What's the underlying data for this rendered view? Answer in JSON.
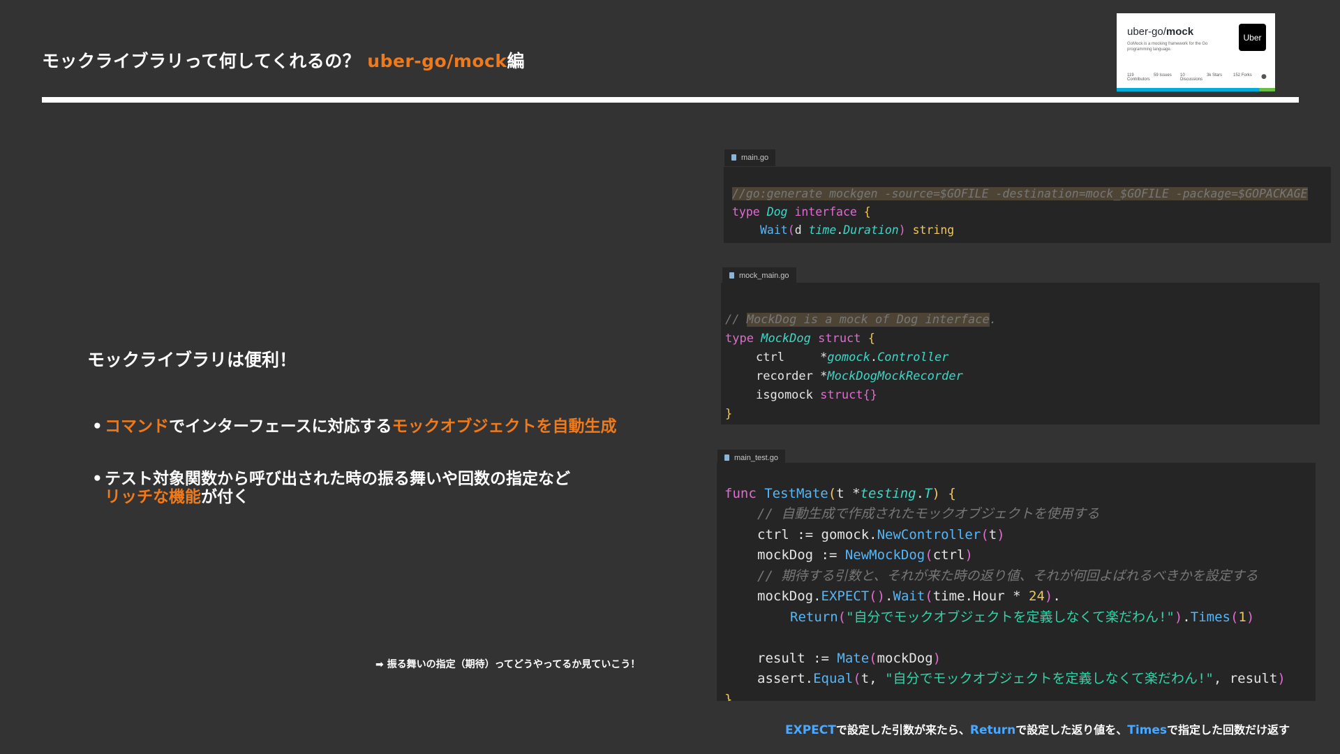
{
  "slide": {
    "title_main": "モックライブラリって何してくれるの？",
    "title_accent": "uber-go/mock",
    "title_suffix": "編",
    "heading": "モックライブラリは便利！",
    "bullet1": {
      "part1": "コマンド",
      "part2": "でインターフェースに対応する",
      "part3": "モックオブジェクトを自動生成"
    },
    "bullet2": {
      "line1": "テスト対象関数から呼び出された時の振る舞いや回数の指定など",
      "part_accent": "リッチな機能",
      "part_tail": "が付く"
    },
    "arrow_note": "➡ 振る舞いの指定（期待）ってどうやってるか見ていこう！",
    "bullet_dot": "•"
  },
  "repo_card": {
    "owner": "uber-go/",
    "name": "mock",
    "description": "GoMock is a mocking framework for the Go programming language.",
    "logo_text": "Uber",
    "stats": [
      {
        "value": "119",
        "label": "Contributors"
      },
      {
        "value": "59",
        "label": "Issues"
      },
      {
        "value": "10",
        "label": "Discussions"
      },
      {
        "value": "3k",
        "label": "Stars"
      },
      {
        "value": "152",
        "label": "Forks"
      }
    ]
  },
  "files": {
    "main": "main.go",
    "mock": "mock_main.go",
    "test": "main_test.go"
  },
  "code_main": {
    "l1": "//go:generate mockgen -source=$GOFILE -destination=mock_$GOFILE -package=$GOPACKAGE",
    "l2_kw": "type",
    "l2_name": "Dog",
    "l2_kw2": "interface",
    "l2_brace": "{",
    "l3_fn": "Wait",
    "l3_open": "(",
    "l3_param": "d ",
    "l3_pkg": "time",
    "l3_dot": ".",
    "l3_type": "Duration",
    "l3_close": ")",
    "l3_ret": "string",
    "l4": "}"
  },
  "code_mock": {
    "l1_prefix": "// ",
    "l1_hl": "MockDog is a mock of Dog interface",
    "l1_end": ".",
    "l2_kw": "type",
    "l2_name": "MockDog",
    "l2_kw2": "struct",
    "l2_brace": "{",
    "l3_field": "ctrl",
    "l3_star": "*",
    "l3_pkg": "gomock",
    "l3_dot": ".",
    "l3_type": "Controller",
    "l4_field": "recorder",
    "l4_star": "*",
    "l4_type": "MockDogMockRecorder",
    "l5_field": "isgomock",
    "l5_type": "struct{}",
    "l6": "}"
  },
  "code_test": {
    "l1_kw": "func",
    "l1_fn": "TestMate",
    "l1_open": "(",
    "l1_param": "t ",
    "l1_star": "*",
    "l1_pkg": "testing",
    "l1_dot": ".",
    "l1_type": "T",
    "l1_close": ")",
    "l1_brace": "{",
    "l2": "// 自動生成で作成されたモックオブジェクトを使用する",
    "l3_var": "ctrl := gomock.",
    "l3_fn": "NewController",
    "l3_open": "(",
    "l3_arg": "t",
    "l3_close": ")",
    "l4_var": "mockDog := ",
    "l4_fn": "NewMockDog",
    "l4_open": "(",
    "l4_arg": "ctrl",
    "l4_close": ")",
    "l5": "// 期待する引数と、それが来た時の返り値、それが何回よばれるべきかを設定する",
    "l6_var": "mockDog.",
    "l6_fn": "EXPECT",
    "l6_parens": "()",
    "l6_dot": ".",
    "l6_fn2": "Wait",
    "l6_open": "(",
    "l6_arg": "time.Hour * ",
    "l6_num": "24",
    "l6_close": ")",
    "l6_end": ".",
    "l7_fn": "Return",
    "l7_open": "(",
    "l7_str": "\"自分でモックオブジェクトを定義しなくて楽だわん!\"",
    "l7_close": ")",
    "l7_dot": ".",
    "l7_fn2": "Times",
    "l7_open2": "(",
    "l7_num": "1",
    "l7_close2": ")",
    "l9_var": "result := ",
    "l9_fn": "Mate",
    "l9_open": "(",
    "l9_arg": "mockDog",
    "l9_close": ")",
    "l10_var": "assert.",
    "l10_fn": "Equal",
    "l10_open": "(",
    "l10_arg": "t, ",
    "l10_str": "\"自分でモックオブジェクトを定義しなくて楽だわん!\"",
    "l10_rest": ", result",
    "l10_close": ")",
    "l11": "}"
  },
  "footnote": {
    "expect": "EXPECT",
    "t1": "で設定した引数が来たら、",
    "ret": "Return",
    "t2": "で設定した返り値を、",
    "times": "Times",
    "t3": "で指定した回数だけ返す"
  }
}
